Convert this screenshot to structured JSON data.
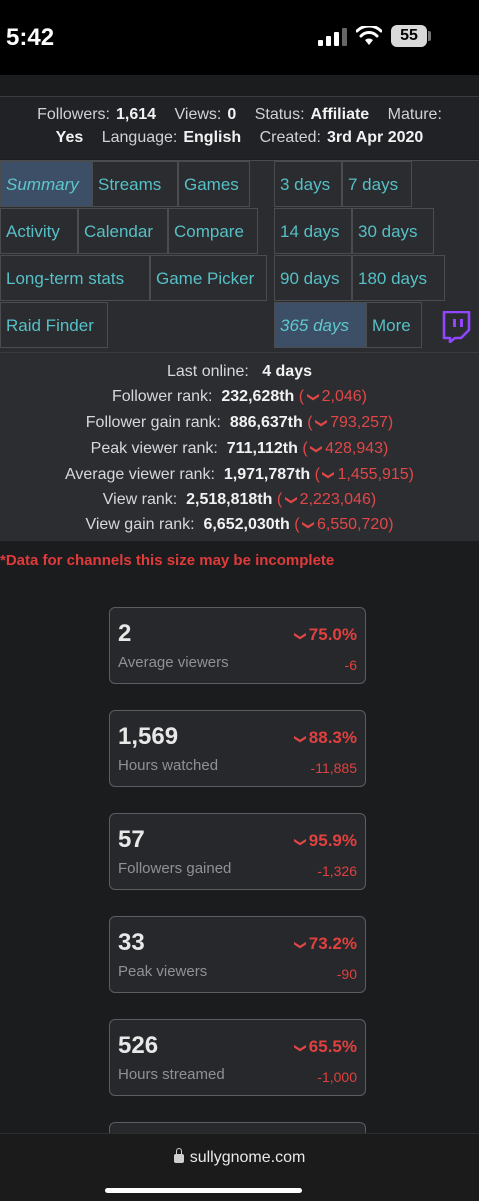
{
  "status_bar": {
    "time": "5:42",
    "battery": "55"
  },
  "channel_info": {
    "followers_label": "Followers:",
    "followers": "1,614",
    "views_label": "Views:",
    "views": "0",
    "status_label": "Status:",
    "status": "Affiliate",
    "mature_label": "Mature:",
    "mature": "Yes",
    "language_label": "Language:",
    "language": "English",
    "created_label": "Created:",
    "created": "3rd Apr 2020"
  },
  "nav_tabs": [
    {
      "label": "Summary",
      "active": true
    },
    {
      "label": "Streams"
    },
    {
      "label": "Games"
    },
    {
      "label": "Activity"
    },
    {
      "label": "Calendar"
    },
    {
      "label": "Compare"
    },
    {
      "label": "Long-term stats"
    },
    {
      "label": "Game Picker"
    },
    {
      "label": "Raid Finder"
    }
  ],
  "time_tabs": [
    {
      "label": "3 days"
    },
    {
      "label": "7 days"
    },
    {
      "label": "14 days"
    },
    {
      "label": "30 days"
    },
    {
      "label": "90 days"
    },
    {
      "label": "180 days"
    },
    {
      "label": "365 days",
      "active": true
    },
    {
      "label": "More"
    }
  ],
  "twitch_icon": "twitch-icon",
  "ranks": {
    "last_online_label": "Last online:",
    "last_online": "4 days",
    "items": [
      {
        "label": "Follower rank:",
        "value": "232,628th",
        "change": "2,046"
      },
      {
        "label": "Follower gain rank:",
        "value": "886,637th",
        "change": "793,257"
      },
      {
        "label": "Peak viewer rank:",
        "value": "711,112th",
        "change": "428,943"
      },
      {
        "label": "Average viewer rank:",
        "value": "1,971,787th",
        "change": "1,455,915"
      },
      {
        "label": "View rank:",
        "value": "2,518,818th",
        "change": "2,223,046"
      },
      {
        "label": "View gain rank:",
        "value": "6,652,030th",
        "change": "6,550,720"
      }
    ]
  },
  "warning": "*Data for channels this size may be incomplete",
  "stat_cards": [
    {
      "value": "2",
      "label": "Average viewers",
      "pct": "75.0%",
      "abs": "-6"
    },
    {
      "value": "1,569",
      "label": "Hours watched",
      "pct": "88.3%",
      "abs": "-11,885"
    },
    {
      "value": "57",
      "label": "Followers gained",
      "pct": "95.9%",
      "abs": "-1,326"
    },
    {
      "value": "33",
      "label": "Peak viewers",
      "pct": "73.2%",
      "abs": "-90"
    },
    {
      "value": "526",
      "label": "Hours streamed",
      "pct": "65.5%",
      "abs": "-1,000"
    }
  ],
  "browser": {
    "url": "sullygnome.com"
  },
  "colors": {
    "accent": "#56c0c6",
    "negative": "#e0413f",
    "active_tab": "#3c4f66",
    "twitch": "#9146ff"
  }
}
